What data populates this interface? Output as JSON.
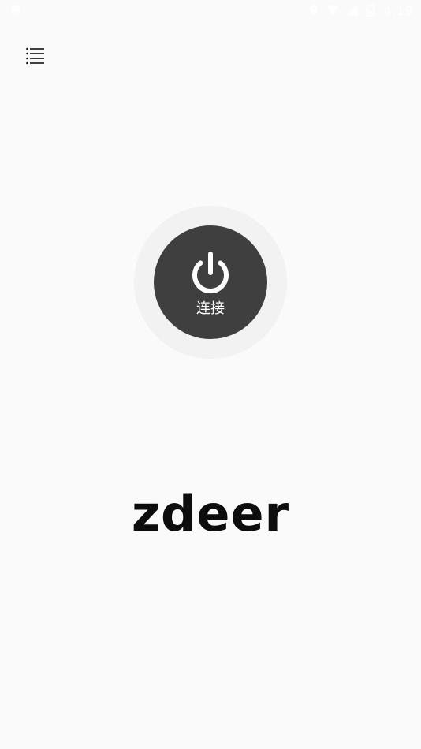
{
  "status_bar": {
    "time": "4:19",
    "icons": [
      "notification-icon",
      "location-icon",
      "wifi-icon",
      "signal-icon",
      "battery-icon"
    ]
  },
  "header": {
    "menu_icon": "menu-icon"
  },
  "connect": {
    "label": "连接",
    "icon": "power-icon"
  },
  "brand": {
    "logo_text": "zdeer"
  },
  "colors": {
    "background": "#fafafa",
    "button": "#3f3f3f",
    "halo": "#f2f2f2",
    "logo": "#0d0d0d"
  }
}
